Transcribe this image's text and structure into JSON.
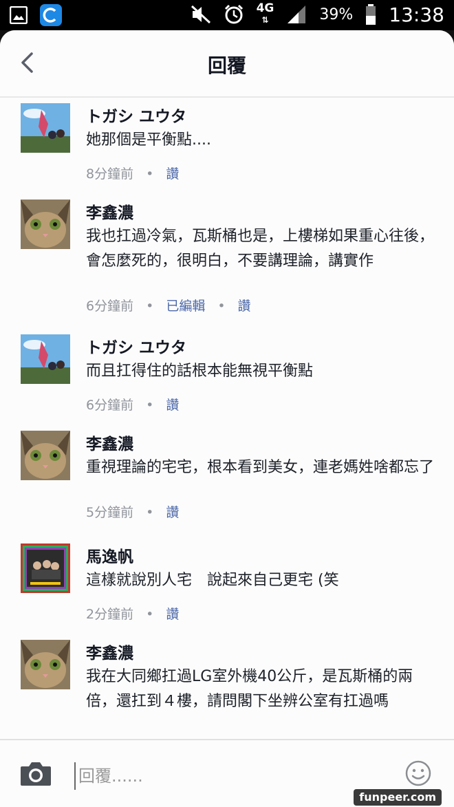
{
  "status_bar": {
    "network": "4G",
    "battery": "39%",
    "time": "13:38"
  },
  "header": {
    "title": "回覆"
  },
  "comments": [
    {
      "name": "トガシ ユウタ",
      "text": "她那個是平衡點....",
      "time": "8分鐘前",
      "edited": "",
      "action": "讚",
      "avatar": "anime-avatar"
    },
    {
      "name": "李鑫濃",
      "text": "我也扛過冷氣，瓦斯桶也是，上樓梯如果重心往後，會怎麼死的，很明白，不要講理論，講實作",
      "time": "6分鐘前",
      "edited": "已編輯",
      "action": "讚",
      "avatar": "cat-avatar"
    },
    {
      "name": "トガシ ユウタ",
      "text": "而且扛得住的話根本能無視平衡點",
      "time": "6分鐘前",
      "edited": "",
      "action": "讚",
      "avatar": "anime-avatar"
    },
    {
      "name": "李鑫濃",
      "text": "重視理論的宅宅，根本看到美女，連老媽姓啥都忘了",
      "time": "5分鐘前",
      "edited": "",
      "action": "讚",
      "avatar": "cat-avatar"
    },
    {
      "name": "馬逸帆",
      "text": "這樣就說別人宅　說起來自己更宅 (笑",
      "time": "2分鐘前",
      "edited": "",
      "action": "讚",
      "avatar": "group-photo-avatar"
    },
    {
      "name": "李鑫濃",
      "text": "我在大同鄉扛過LG室外機40公斤，是瓦斯桶的兩倍，還扛到４樓，請問閣下坐辨公室有扛過嗎",
      "time": "",
      "edited": "",
      "action": "",
      "avatar": "cat-avatar"
    }
  ],
  "composer": {
    "placeholder": "回覆......"
  },
  "watermark": "funpeer.com"
}
